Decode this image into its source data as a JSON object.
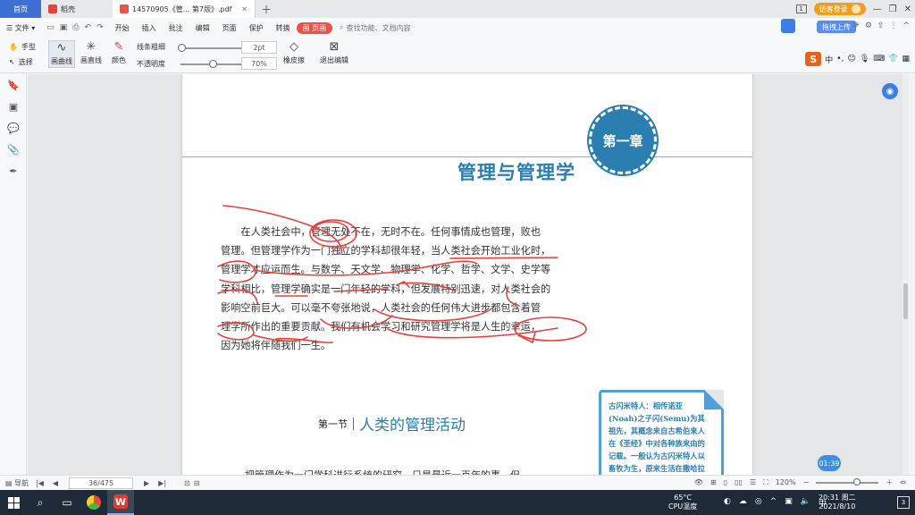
{
  "tabs": {
    "home": "首页",
    "wps": "稻壳",
    "doc": "14570905《管... 第7版》.pdf"
  },
  "titlebar": {
    "login": "访客登录",
    "badge": "1"
  },
  "menu": {
    "file": "文件",
    "items": [
      "开始",
      "插入",
      "批注",
      "编辑",
      "页面",
      "保护",
      "转换"
    ],
    "active": "画 页画",
    "search": "查找功能、文档内容",
    "upload": "拖拽上传"
  },
  "toolbar": {
    "hand": "手型",
    "select": "选择",
    "curve": "画曲线",
    "straight": "画直线",
    "color": "颜色",
    "thickness_label": "线条粗细",
    "opacity_label": "不透明度",
    "thickness_value": "2pt",
    "opacity_value": "70%",
    "eraser": "橡皮擦",
    "exit": "退出编辑",
    "ime": "中"
  },
  "page": {
    "chapter_badge": "第一章",
    "chapter_title": "管理与管理学",
    "lines": [
      "在人类社会中，管理无处不在，无时不在。任何事情成也管理，败也",
      "管理。但管理学作为一门独立的学科却很年轻，当人类社会开始工业化时，",
      "管理学才应运而生。与数学、天文学、物理学、化学、哲学、文学、史学等",
      "学科相比，管理学确实是一门年轻的学科，但发展特别迅速，对人类社会的",
      "影响空前巨大。可以毫不夸张地说，人类社会的任何伟大进步都包含着管",
      "理学所作出的重要贡献。我们有机会学习和研究管理学将是人生的幸运，",
      "因为她将伴随我们一生。"
    ],
    "section_number": "第一节",
    "section_title": "人类的管理活动",
    "sidenote": [
      "古闪米特人：相传诺亚",
      "(Noah)之子闪(Semu)为其",
      "祖先，其概念来自古希伯来人",
      "在《圣经》中对各种族来由的",
      "记载。一般认为古闪米特人以",
      "畜牧为生，原来生活在撒哈拉"
    ],
    "bottom_text": "把管理作为一门学科进行系统的研究，只是最近一百年的事。但"
  },
  "timer": "01:39",
  "status": {
    "nav_label": "导航",
    "page": "36/475",
    "zoom": "120%"
  },
  "taskbar": {
    "weather_temp": "65°C",
    "weather_label": "CPU温度",
    "time": "20:31 周二",
    "date": "2021/8/10",
    "ime": "中"
  },
  "colors": {
    "accent": "#2a7fb0",
    "ink": "#e8413a",
    "active_menu": "#e8534a"
  }
}
